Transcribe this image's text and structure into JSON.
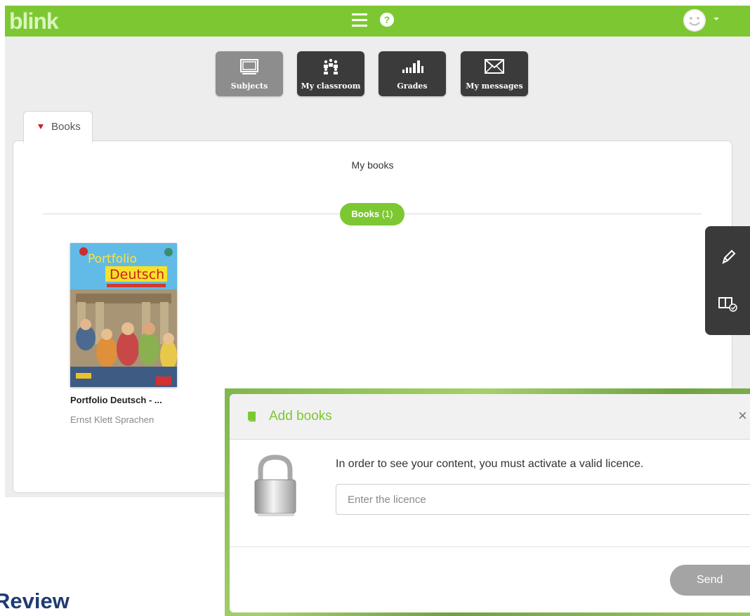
{
  "app": {
    "brand": "blink"
  },
  "topbar": {
    "menu_icon": "hamburger-icon",
    "help_icon": "question-icon",
    "help_glyph": "?",
    "avatar_icon": "smiley-icon"
  },
  "nav": [
    {
      "label": "Subjects",
      "icon": "subjects-icon",
      "active": true
    },
    {
      "label": "My classroom",
      "icon": "classroom-icon",
      "active": false
    },
    {
      "label": "Grades",
      "icon": "grades-icon",
      "active": false
    },
    {
      "label": "My messages",
      "icon": "messages-icon",
      "active": false
    }
  ],
  "tab": {
    "label": "Books"
  },
  "content": {
    "heading": "My books",
    "books_pill": {
      "label": "Books",
      "count": "(1)"
    },
    "books": [
      {
        "title": "Portfolio Deutsch - ...",
        "publisher": "Ernst Klett Sprachen",
        "cover_title_1": "Portfolio",
        "cover_title_2": "Deutsch"
      }
    ]
  },
  "sidetools": {
    "items": [
      "pencil-icon",
      "book-check-icon"
    ]
  },
  "modal": {
    "title": "Add books",
    "close_glyph": "×",
    "message": "In order to see your content, you must activate a valid licence.",
    "input": {
      "placeholder": "Enter the licence",
      "value": ""
    },
    "send_label": "Send"
  },
  "footer_label": "Review",
  "colors": {
    "brand": "#7dc832",
    "nav_dark": "#3b3b3b",
    "nav_active": "#8d8d8d",
    "send_disabled": "#a4a4a4",
    "review_text": "#1f3b73"
  }
}
